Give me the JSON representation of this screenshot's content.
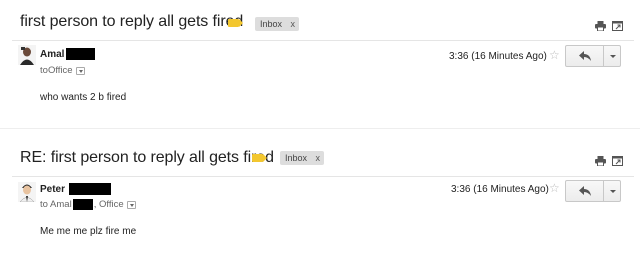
{
  "threads": [
    {
      "subject": "first person to reply all gets fired",
      "label_chip": "Inbox",
      "chip_close": "x",
      "sender": "Amal",
      "recipients": {
        "prefix": "to ",
        "names": [
          "Office"
        ]
      },
      "timestamp": "3:36 (16 Minutes Ago)",
      "body": "who wants 2 b fired"
    },
    {
      "subject": "RE: first person to reply all gets fired",
      "label_chip": "Inbox",
      "chip_close": "x",
      "sender": "Peter",
      "recipients": {
        "prefix": "to Amal",
        "suffix": ", Office"
      },
      "timestamp": "3:36 (16 Minutes Ago)",
      "body": "Me me me plz fire me"
    }
  ],
  "icons": {
    "label": "label-tag-icon",
    "print": "print-icon",
    "new_window": "new-window-icon",
    "star": "star-icon",
    "reply": "reply-icon",
    "more": "chevron-down-icon"
  },
  "colors": {
    "label_tag": "#f3c72f",
    "chip_bg": "#dddddd",
    "divider": "#e5e5e5"
  }
}
